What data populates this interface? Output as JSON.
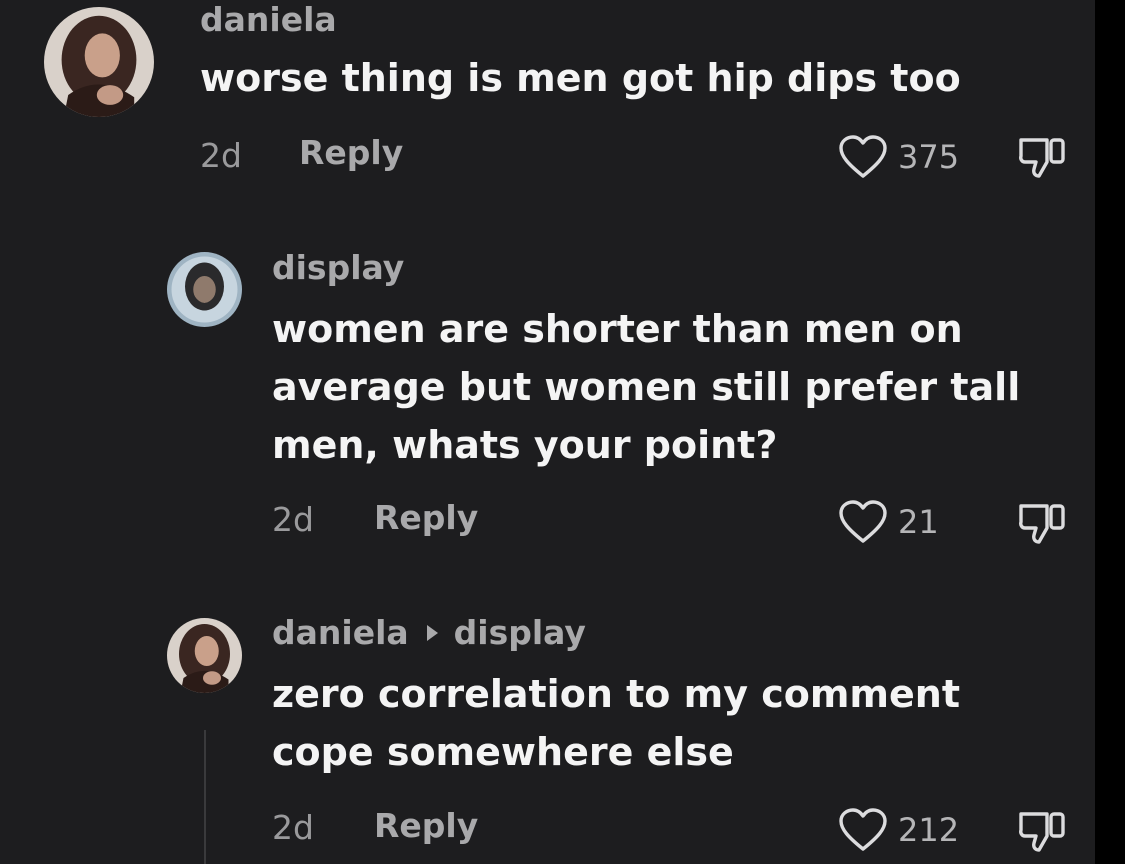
{
  "comments": [
    {
      "username": "daniela",
      "text": "worse thing is men got hip dips too",
      "time": "2d",
      "reply_label": "Reply",
      "likes": "375",
      "avatar_icon": "female-avatar"
    },
    {
      "username": "display",
      "text": "women are shorter than men on\naverage but women still prefer tall\nmen, whats your point?",
      "time": "2d",
      "reply_label": "Reply",
      "likes": "21",
      "avatar_icon": "male-avatar"
    },
    {
      "username": "daniela",
      "reply_to": "display",
      "text": "zero correlation to my comment\ncope somewhere else",
      "time": "2d",
      "reply_label": "Reply",
      "likes": "212",
      "avatar_icon": "female-avatar"
    }
  ],
  "colors": {
    "background": "#1d1d1f",
    "text": "#f4f4f4",
    "muted": "#a9a9ab"
  }
}
